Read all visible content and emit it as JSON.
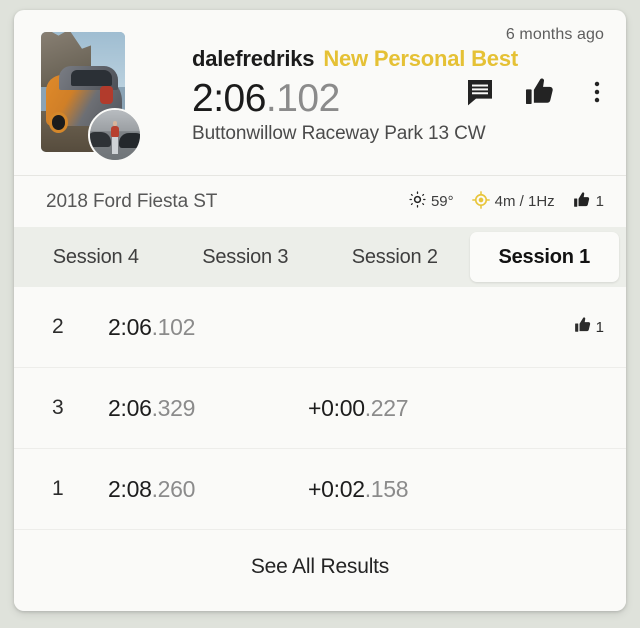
{
  "header": {
    "timestamp": "6 months ago",
    "username": "dalefredriks",
    "personal_best_badge": "New Personal Best",
    "lap_time_main": "2:06",
    "lap_time_fraction": ".102",
    "track_name": "Buttonwillow Raceway Park 13 CW",
    "thumbnail_alt": "car-photo",
    "avatar_alt": "user-avatar",
    "actions": [
      {
        "icon": "comment-icon",
        "name": "comment-button"
      },
      {
        "icon": "thumbs-up-icon",
        "name": "like-button"
      },
      {
        "icon": "more-vertical-icon",
        "name": "more-options-button"
      }
    ]
  },
  "info_bar": {
    "vehicle": "2018 Ford Fiesta ST",
    "temperature": "59°",
    "temperature_icon": "brightness-sun-icon",
    "gps_accuracy": "4m / 1Hz",
    "gps_icon": "gps-target-icon",
    "like_count": "1",
    "like_icon": "thumbs-up-icon"
  },
  "tabs": [
    {
      "label": "Session 4",
      "active": false
    },
    {
      "label": "Session 3",
      "active": false
    },
    {
      "label": "Session 2",
      "active": false
    },
    {
      "label": "Session 1",
      "active": true
    }
  ],
  "laps": [
    {
      "number": "2",
      "time_main": "2:06",
      "time_fraction": ".102",
      "delta_main": "",
      "delta_fraction": "",
      "likes": "1"
    },
    {
      "number": "3",
      "time_main": "2:06",
      "time_fraction": ".329",
      "delta_main": "+0:00",
      "delta_fraction": ".227",
      "likes": ""
    },
    {
      "number": "1",
      "time_main": "2:08",
      "time_fraction": ".260",
      "delta_main": "+0:02",
      "delta_fraction": ".158",
      "likes": ""
    }
  ],
  "footer": {
    "see_all_label": "See All Results"
  },
  "colors": {
    "page_background": "#dfe2db",
    "card_background": "#fafaf8",
    "accent_gold": "#e5c135",
    "tab_bar_background": "#eceee9",
    "text_primary": "#1b1b1b",
    "text_secondary": "#8b8b8b"
  }
}
